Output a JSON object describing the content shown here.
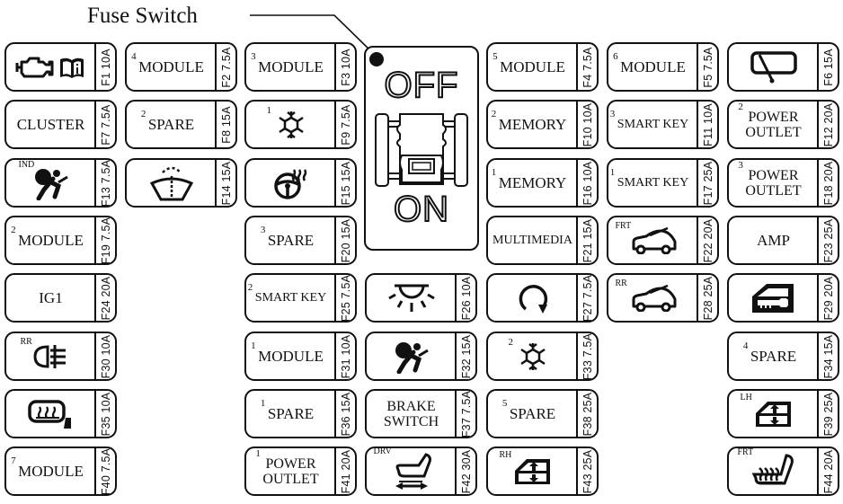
{
  "title": "Fuse Switch",
  "switch": {
    "off_label": "OFF",
    "on_label": "ON"
  },
  "fuses": [
    {
      "id": "F1",
      "rating": "F1 10A",
      "label": "",
      "icon": "engine-manual-icon"
    },
    {
      "id": "F2",
      "rating": "F2 7.5A",
      "label": "MODULE",
      "sup": "4"
    },
    {
      "id": "F3",
      "rating": "F3 10A",
      "label": "MODULE",
      "sup": "3"
    },
    {
      "id": "F4",
      "rating": "F4 7.5A",
      "label": "MODULE",
      "sup": "5"
    },
    {
      "id": "F5",
      "rating": "F5 7.5A",
      "label": "MODULE",
      "sup": "6"
    },
    {
      "id": "F6",
      "rating": "F6 15A",
      "label": "",
      "icon": "sunroof-icon"
    },
    {
      "id": "F7",
      "rating": "F7 7.5A",
      "label": "CLUSTER"
    },
    {
      "id": "F8",
      "rating": "F8 15A",
      "label": "SPARE",
      "sup": "2"
    },
    {
      "id": "F9",
      "rating": "F9 7.5A",
      "label": "",
      "sup": "1",
      "icon": "air-conditioner-icon"
    },
    {
      "id": "F10",
      "rating": "F10 10A",
      "label": "MEMORY",
      "sup": "2"
    },
    {
      "id": "F11",
      "rating": "F11 10A",
      "label": "SMART KEY",
      "sup": "3"
    },
    {
      "id": "F12",
      "rating": "F12 20A",
      "label": "POWER OUTLET",
      "sup": "2"
    },
    {
      "id": "F13",
      "rating": "F13 7.5A",
      "label": "",
      "tag": "IND",
      "icon": "airbag-icon"
    },
    {
      "id": "F14",
      "rating": "F14 15A",
      "label": "",
      "icon": "washer-icon"
    },
    {
      "id": "F15",
      "rating": "F15 15A",
      "label": "",
      "icon": "heated-steering-wheel-icon"
    },
    {
      "id": "F16",
      "rating": "F16 10A",
      "label": "MEMORY",
      "sup": "1"
    },
    {
      "id": "F17",
      "rating": "F17 25A",
      "label": "SMART KEY",
      "sup": "1"
    },
    {
      "id": "F18",
      "rating": "F18 20A",
      "label": "POWER OUTLET",
      "sup": "3"
    },
    {
      "id": "F19",
      "rating": "F19 7.5A",
      "label": "MODULE",
      "sup": "2"
    },
    {
      "id": "F20",
      "rating": "F20 15A",
      "label": "SPARE",
      "sup": "3"
    },
    {
      "id": "F21",
      "rating": "F21 15A",
      "label": "MULTIMEDIA"
    },
    {
      "id": "F22",
      "rating": "F22 20A",
      "label": "",
      "tag": "FRT",
      "icon": "wiper-car-icon"
    },
    {
      "id": "F23",
      "rating": "F23 25A",
      "label": "AMP"
    },
    {
      "id": "F24",
      "rating": "F24 20A",
      "label": "IG1"
    },
    {
      "id": "F25",
      "rating": "F25 7.5A",
      "label": "SMART KEY",
      "sup": "2"
    },
    {
      "id": "F26",
      "rating": "F26 10A",
      "label": "",
      "icon": "room-lamp-icon"
    },
    {
      "id": "F27",
      "rating": "F27 7.5A",
      "label": "",
      "icon": "rotation-arrow-icon"
    },
    {
      "id": "F28",
      "rating": "F28 25A",
      "label": "",
      "tag": "RR",
      "icon": "wiper-car-icon"
    },
    {
      "id": "F29",
      "rating": "F29 20A",
      "label": "",
      "icon": "door-lock-icon"
    },
    {
      "id": "F30",
      "rating": "F30 10A",
      "label": "",
      "tag": "RR",
      "icon": "fog-lamp-icon"
    },
    {
      "id": "F31",
      "rating": "F31 10A",
      "label": "MODULE",
      "sup": "1"
    },
    {
      "id": "F32",
      "rating": "F32 15A",
      "label": "",
      "icon": "airbag-icon"
    },
    {
      "id": "F33",
      "rating": "F33 7.5A",
      "label": "",
      "sup": "2",
      "icon": "air-conditioner-icon"
    },
    {
      "id": "F34",
      "rating": "F34 15A",
      "label": "SPARE",
      "sup": "4"
    },
    {
      "id": "F35",
      "rating": "F35 10A",
      "label": "",
      "icon": "heated-mirror-icon"
    },
    {
      "id": "F36",
      "rating": "F36 15A",
      "label": "SPARE",
      "sup": "1"
    },
    {
      "id": "F37",
      "rating": "F37 7.5A",
      "label": "BRAKE SWITCH"
    },
    {
      "id": "F38",
      "rating": "F38 25A",
      "label": "SPARE",
      "sup": "5"
    },
    {
      "id": "F39",
      "rating": "F39 25A",
      "label": "",
      "tag": "LH",
      "icon": "power-window-icon"
    },
    {
      "id": "F40",
      "rating": "F40 7.5A",
      "label": "MODULE",
      "sup": "7"
    },
    {
      "id": "F41",
      "rating": "F41 20A",
      "label": "POWER OUTLET",
      "sup": "1"
    },
    {
      "id": "F42",
      "rating": "F42 30A",
      "label": "",
      "tag": "DRV",
      "icon": "power-seat-icon"
    },
    {
      "id": "F43",
      "rating": "F43 25A",
      "label": "",
      "tag": "RH",
      "icon": "power-window-icon"
    },
    {
      "id": "F44",
      "rating": "F44 20A",
      "label": "",
      "tag": "FRT",
      "icon": "seat-heater-icon"
    }
  ]
}
